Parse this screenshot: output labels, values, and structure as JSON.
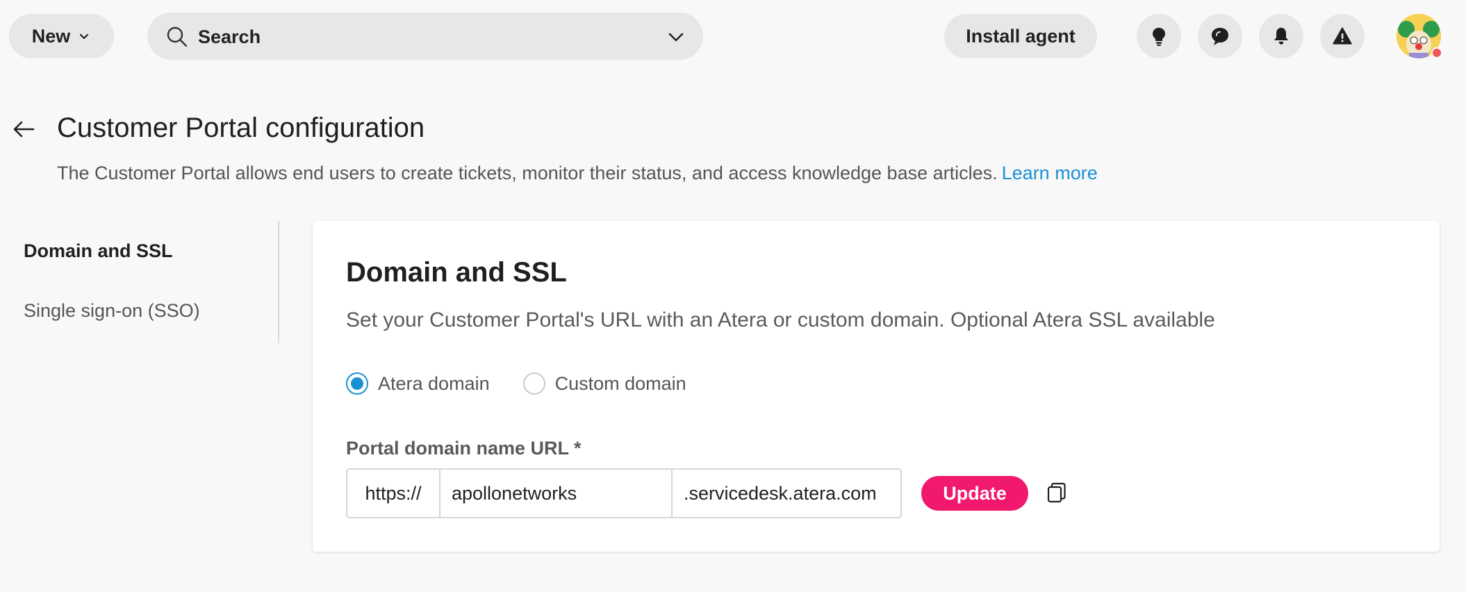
{
  "topbar": {
    "new_label": "New",
    "search_label": "Search",
    "install_agent_label": "Install agent",
    "icons": [
      "lightbulb-icon",
      "chat-icon",
      "bell-icon",
      "warning-icon"
    ]
  },
  "page": {
    "title": "Customer Portal configuration",
    "description": "The Customer Portal allows end users to create tickets, monitor their status, and access knowledge base articles.",
    "learn_more": "Learn more"
  },
  "sidenav": {
    "items": [
      {
        "label": "Domain and SSL",
        "active": true
      },
      {
        "label": "Single sign-on (SSO)",
        "active": false
      }
    ]
  },
  "card": {
    "title": "Domain and SSL",
    "description": "Set your Customer Portal's URL with an Atera or custom domain. Optional Atera SSL available",
    "radio_options": [
      {
        "label": "Atera domain",
        "selected": true
      },
      {
        "label": "Custom domain",
        "selected": false
      }
    ],
    "field_label": "Portal domain name URL *",
    "url_prefix": "https://",
    "url_value": "apollonetworks",
    "url_suffix": ".servicedesk.atera.com",
    "update_label": "Update"
  },
  "colors": {
    "accent": "#1a8fd6",
    "update_button": "#f0196e",
    "notification_dot": "#f2545b"
  }
}
